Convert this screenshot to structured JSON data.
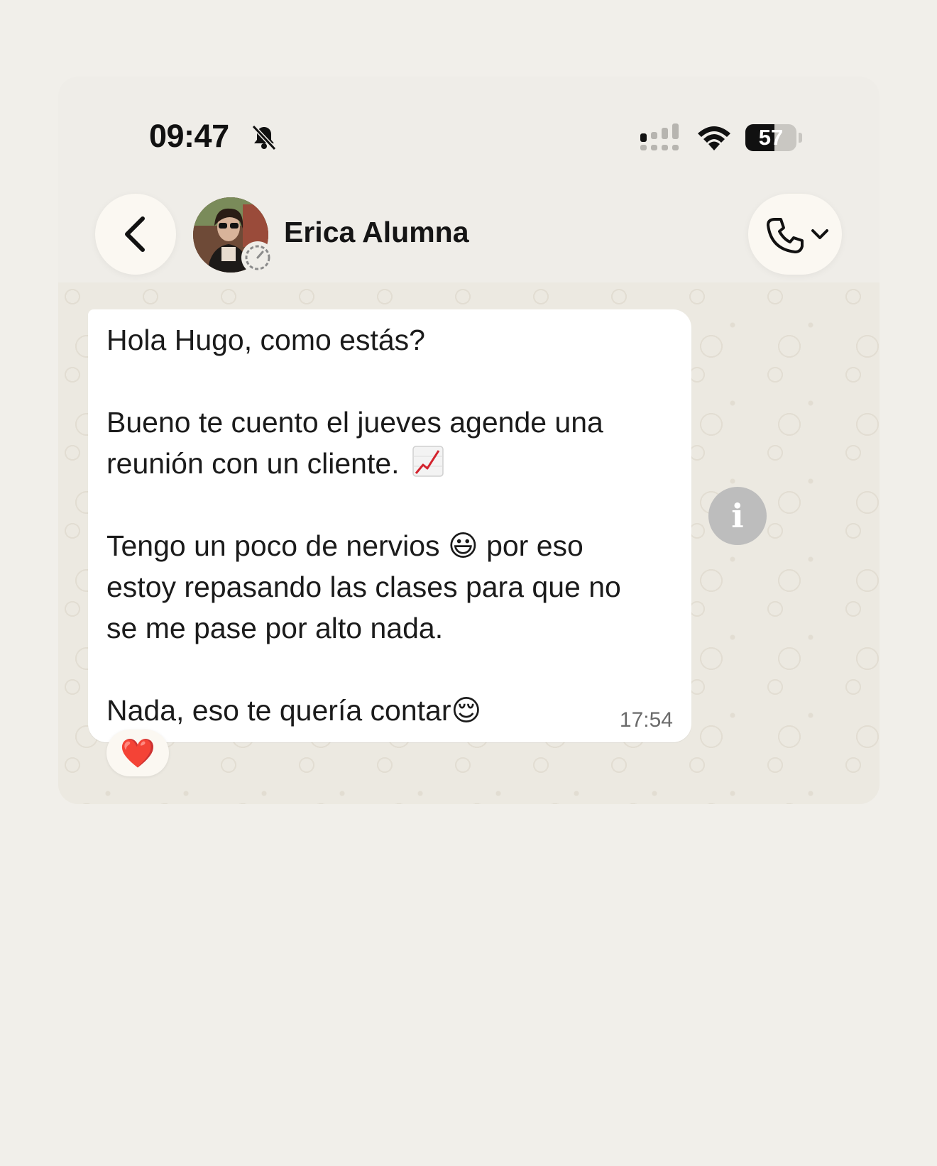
{
  "status_bar": {
    "time": "09:47",
    "battery_level": "57",
    "battery_fraction": 0.57,
    "icons": [
      "bell-slash-icon",
      "cellular-signal-icon",
      "wifi-icon",
      "battery-icon"
    ]
  },
  "header": {
    "back_icon": "chevron-left-icon",
    "contact_name": "Erica Alumna",
    "avatar": "contact-avatar",
    "call_icon": "phone-icon",
    "call_dropdown_icon": "chevron-down-icon"
  },
  "message": {
    "lines": [
      "Hola Hugo, como estás?",
      "Bueno te cuento el jueves agende una",
      "reunión con un cliente.",
      "Tengo un poco de nervios 😃 por eso",
      "estoy repasando las clases para que no",
      "se me pase por alto nada.",
      "Nada, eso te quería contar😌"
    ],
    "time": "17:54",
    "reaction": "❤️",
    "inline_icon": "chart-increasing-icon"
  },
  "info_button": "i",
  "colors": {
    "background": "#f1efea",
    "bubble": "#ffffff",
    "reaction_heart": "#d8202f",
    "info_button": "#bdbdbd"
  }
}
